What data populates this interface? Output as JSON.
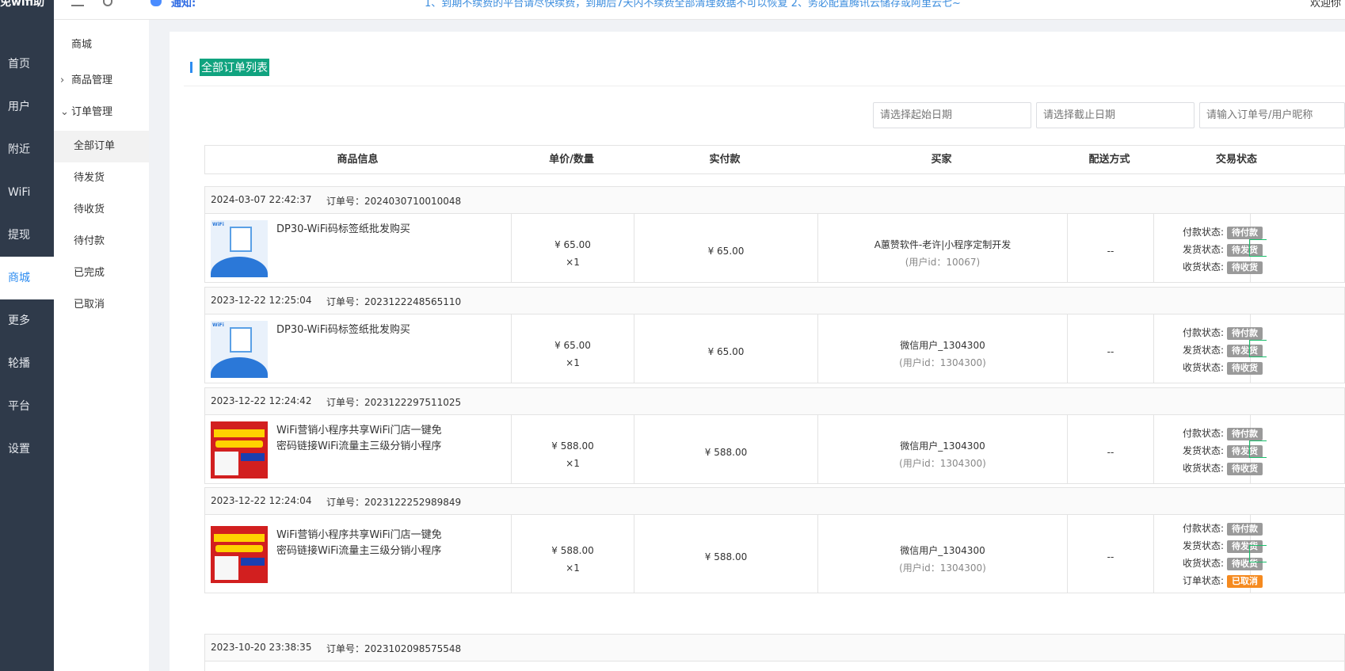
{
  "app": {
    "logo": "免wifi助"
  },
  "header": {
    "notice_label": "通知:",
    "notice_text": "1、到期不续费的平台请尽快续费，到期后7天内不续费全部清理数据不可以恢复 2、务必配置腾讯云储存或阿里云七~",
    "welcome": "欢迎你"
  },
  "sidebar": {
    "items": [
      {
        "label": "首页"
      },
      {
        "label": "用户"
      },
      {
        "label": "附近"
      },
      {
        "label": "WiFi"
      },
      {
        "label": "提现"
      },
      {
        "label": "商城"
      },
      {
        "label": "更多"
      },
      {
        "label": "轮播"
      },
      {
        "label": "平台"
      },
      {
        "label": "设置"
      }
    ],
    "active": "商城"
  },
  "subnav": {
    "title": "商城",
    "groups": [
      {
        "label": "商品管理",
        "chevron": "›"
      },
      {
        "label": "订单管理",
        "chevron": "⌄"
      }
    ],
    "items": [
      {
        "label": "全部订单"
      },
      {
        "label": "待发货"
      },
      {
        "label": "待收货"
      },
      {
        "label": "待付款"
      },
      {
        "label": "已完成"
      },
      {
        "label": "已取消"
      }
    ]
  },
  "main": {
    "title": "全部订单列表",
    "filters": {
      "start_placeholder": "请选择起始日期",
      "end_placeholder": "请选择截止日期",
      "search_placeholder": "请输入订单号/用户昵称"
    },
    "columns": [
      "商品信息",
      "单价/数量",
      "实付款",
      "买家",
      "配送方式",
      "交易状态"
    ],
    "status_labels": {
      "pay": "付款状态:",
      "ship": "发货状态:",
      "receive": "收货状态:",
      "order": "订单状态:"
    },
    "orders": [
      {
        "date": "2024-03-07 22:42:37",
        "order_no": "订单号：2024030710010048",
        "product": "DP30-WiFi码标签纸批发购买",
        "thumb": "label",
        "price": "¥ 65.00",
        "qty": "×1",
        "paid": "¥ 65.00",
        "buyer": "A蕙赞软件-老许|小程序定制开发",
        "buyer_id": "(用户id：10067)",
        "shipping": "--",
        "pay_status": "待付款",
        "ship_status": "待发货",
        "receive_status": "待收货"
      },
      {
        "date": "2023-12-22 12:25:04",
        "order_no": "订单号：2023122248565110",
        "product": "DP30-WiFi码标签纸批发购买",
        "thumb": "label",
        "price": "¥ 65.00",
        "qty": "×1",
        "paid": "¥ 65.00",
        "buyer": "微信用户_1304300",
        "buyer_id": "(用户id：1304300)",
        "shipping": "--",
        "pay_status": "待付款",
        "ship_status": "待发货",
        "receive_status": "待收货"
      },
      {
        "date": "2023-12-22 12:24:42",
        "order_no": "订单号：2023122297511025",
        "product": "WiFi营销小程序共享WiFi门店一键免密码链接WiFi流量主三级分销小程序",
        "thumb": "red",
        "price": "¥ 588.00",
        "qty": "×1",
        "paid": "¥ 588.00",
        "buyer": "微信用户_1304300",
        "buyer_id": "(用户id：1304300)",
        "shipping": "--",
        "pay_status": "待付款",
        "ship_status": "待发货",
        "receive_status": "待收货"
      },
      {
        "date": "2023-12-22 12:24:04",
        "order_no": "订单号：2023122252989849",
        "product": "WiFi营销小程序共享WiFi门店一键免密码链接WiFi流量主三级分销小程序",
        "thumb": "red",
        "price": "¥ 588.00",
        "qty": "×1",
        "paid": "¥ 588.00",
        "buyer": "微信用户_1304300",
        "buyer_id": "(用户id：1304300)",
        "shipping": "--",
        "pay_status": "待付款",
        "ship_status": "待发货",
        "receive_status": "待收货",
        "order_status": "已取消"
      },
      {
        "date": "2023-10-20 23:38:35",
        "order_no": "订单号：2023102098575548"
      }
    ]
  },
  "colors": {
    "sidebar_bg": "#2f3a4a",
    "accent": "#2d8cf0",
    "title_bg": "#10a37f",
    "badge_gray": "#9a9a9a",
    "badge_orange": "#f58a1f"
  }
}
